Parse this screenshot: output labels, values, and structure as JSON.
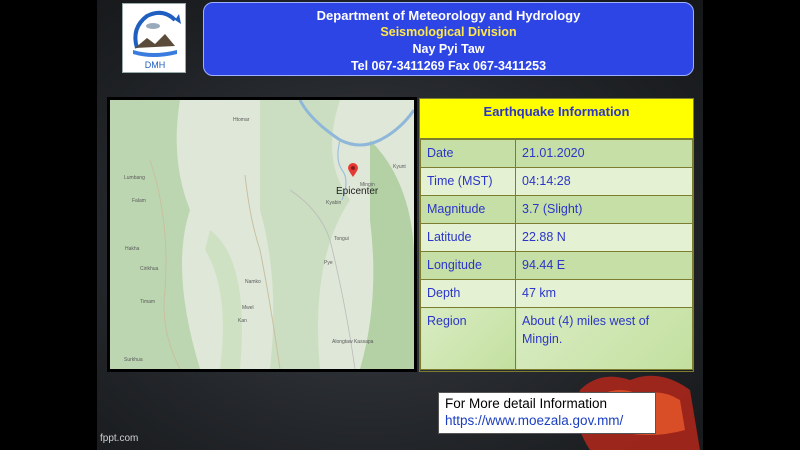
{
  "header": {
    "department": "Department of Meteorology and Hydrology",
    "division": "Seismological  Division",
    "city": "Nay Pyi Taw",
    "contact": "Tel 067-3411269  Fax 067-3411253"
  },
  "logo": {
    "text": "DMH"
  },
  "map": {
    "epicenter_label": "Epicenter",
    "places": [
      "Kyunt",
      "Htomar",
      "Lumbang",
      "Falam",
      "Mingin",
      "Kyabin",
      "Hakha",
      "Tongui",
      "Cirikhua",
      "Pye",
      "Namko",
      "Timam",
      "Mwel",
      "Kan",
      "Alongtaw Kassapa",
      "Surkhua"
    ]
  },
  "info": {
    "title": "Earthquake Information",
    "rows": [
      {
        "label": "Date",
        "value": "21.01.2020"
      },
      {
        "label": "Time (MST)",
        "value": "04:14:28"
      },
      {
        "label": "Magnitude",
        "value": "3.7 (Slight)"
      },
      {
        "label": "Latitude",
        "value": "22.88 N"
      },
      {
        "label": "Longitude",
        "value": "94.44 E"
      },
      {
        "label": "Depth",
        "value": "47 km"
      },
      {
        "label": "Region",
        "value": "About (4) miles west of Mingin."
      }
    ]
  },
  "more_info": {
    "label": "For More detail Information",
    "url": "https://www.moezala.gov.mm/"
  },
  "watermark": "fppt.com",
  "colors": {
    "header_bg": "#2e45e6",
    "division_text": "#ffe84a",
    "table_title_bg": "#ffff00",
    "table_text": "#2b35c9",
    "row_dark": "#c5dfa6",
    "row_light": "#e4f1d3"
  }
}
